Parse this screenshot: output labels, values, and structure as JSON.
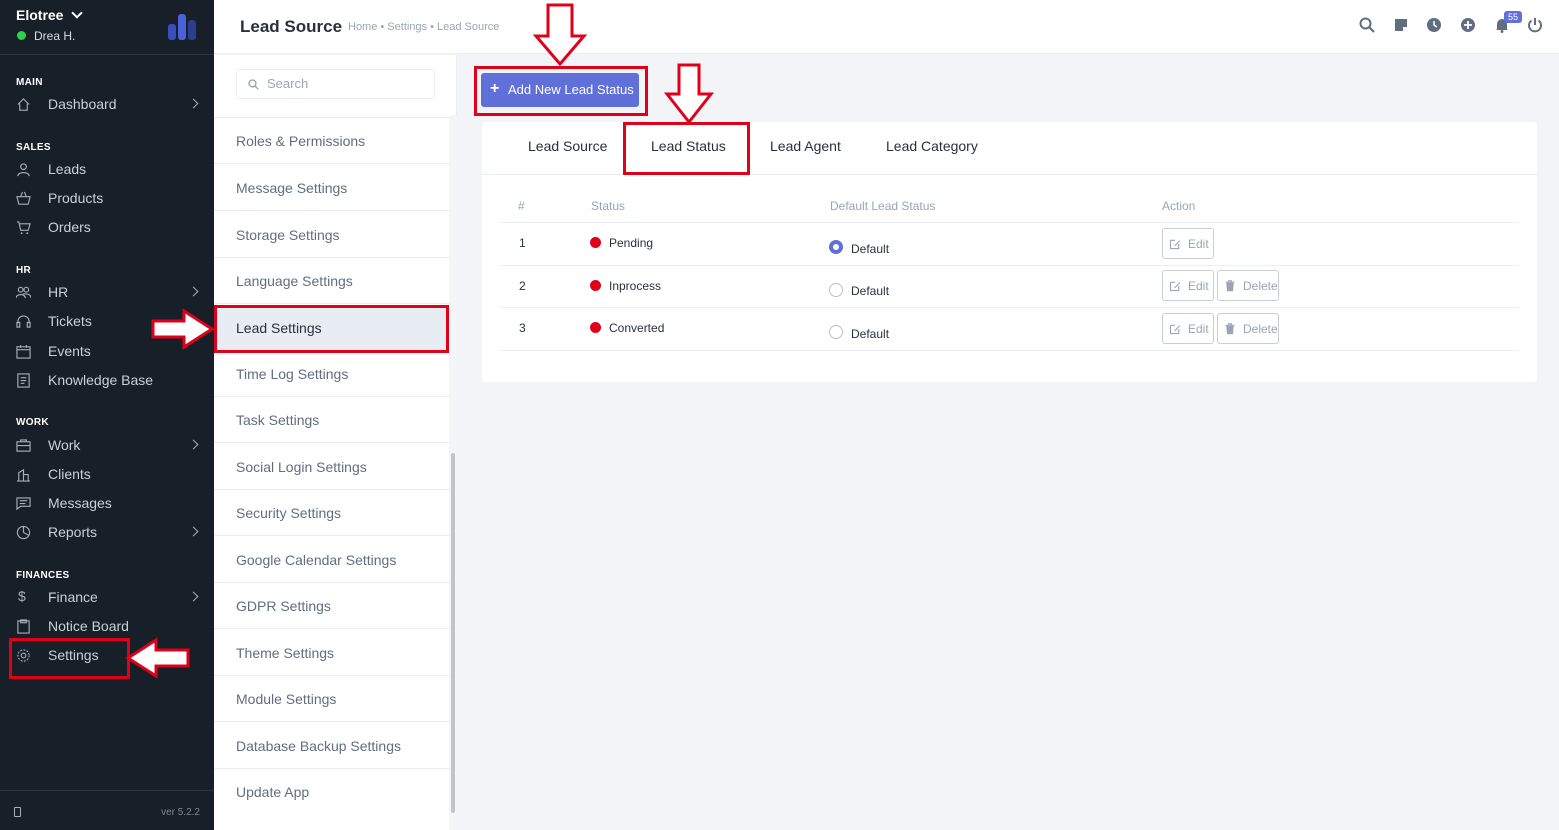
{
  "sidebar": {
    "workspace": "Elotree",
    "user": "Drea H.",
    "sections": [
      {
        "title": "MAIN",
        "items": [
          {
            "label": "Dashboard",
            "icon": "home-icon",
            "arrow": true
          }
        ]
      },
      {
        "title": "SALES",
        "items": [
          {
            "label": "Leads",
            "icon": "user-icon",
            "arrow": false
          },
          {
            "label": "Products",
            "icon": "basket-icon",
            "arrow": false
          },
          {
            "label": "Orders",
            "icon": "cart-icon",
            "arrow": false
          }
        ]
      },
      {
        "title": "HR",
        "items": [
          {
            "label": "HR",
            "icon": "people-icon",
            "arrow": true
          },
          {
            "label": "Tickets",
            "icon": "headset-icon",
            "arrow": false
          },
          {
            "label": "Events",
            "icon": "calendar-icon",
            "arrow": false
          },
          {
            "label": "Knowledge Base",
            "icon": "book-icon",
            "arrow": false
          }
        ]
      },
      {
        "title": "WORK",
        "items": [
          {
            "label": "Work",
            "icon": "briefcase-icon",
            "arrow": true
          },
          {
            "label": "Clients",
            "icon": "building-icon",
            "arrow": false
          },
          {
            "label": "Messages",
            "icon": "message-icon",
            "arrow": false
          },
          {
            "label": "Reports",
            "icon": "pie-chart-icon",
            "arrow": true
          }
        ]
      },
      {
        "title": "FINANCES",
        "items": [
          {
            "label": "Finance",
            "icon": "dollar-icon",
            "arrow": true
          },
          {
            "label": "Notice Board",
            "icon": "clipboard-icon",
            "arrow": false
          },
          {
            "label": "Settings",
            "icon": "gear-icon",
            "arrow": false
          }
        ]
      }
    ],
    "version": "ver 5.2.2"
  },
  "header": {
    "title": "Lead Source",
    "breadcrumb": "Home • Settings • Lead Source",
    "notification_count": "55"
  },
  "settings_menu": {
    "search_placeholder": "Search",
    "items": [
      "Roles & Permissions",
      "Message Settings",
      "Storage Settings",
      "Language Settings",
      "Lead Settings",
      "Time Log Settings",
      "Task Settings",
      "Social Login Settings",
      "Security Settings",
      "Google Calendar Settings",
      "GDPR Settings",
      "Theme Settings",
      "Module Settings",
      "Database Backup Settings",
      "Update App"
    ],
    "active": "Lead Settings"
  },
  "main": {
    "add_button": "Add New Lead Status",
    "tabs": [
      "Lead Source",
      "Lead Status",
      "Lead Agent",
      "Lead Category"
    ],
    "active_tab": "Lead Status",
    "table": {
      "headers": [
        "#",
        "Status",
        "Default Lead Status",
        "Action"
      ],
      "rows": [
        {
          "num": "1",
          "status": "Pending",
          "default_label": "Default",
          "is_default": true,
          "deletable": false
        },
        {
          "num": "2",
          "status": "Inprocess",
          "default_label": "Default",
          "is_default": false,
          "deletable": true
        },
        {
          "num": "3",
          "status": "Converted",
          "default_label": "Default",
          "is_default": false,
          "deletable": true
        }
      ],
      "edit_label": "Edit",
      "delete_label": "Delete"
    }
  },
  "colors": {
    "sidebar_bg": "#171f29",
    "accent": "#616fd9",
    "status_red": "#e1001a",
    "annotation_red": "#e1001a"
  }
}
